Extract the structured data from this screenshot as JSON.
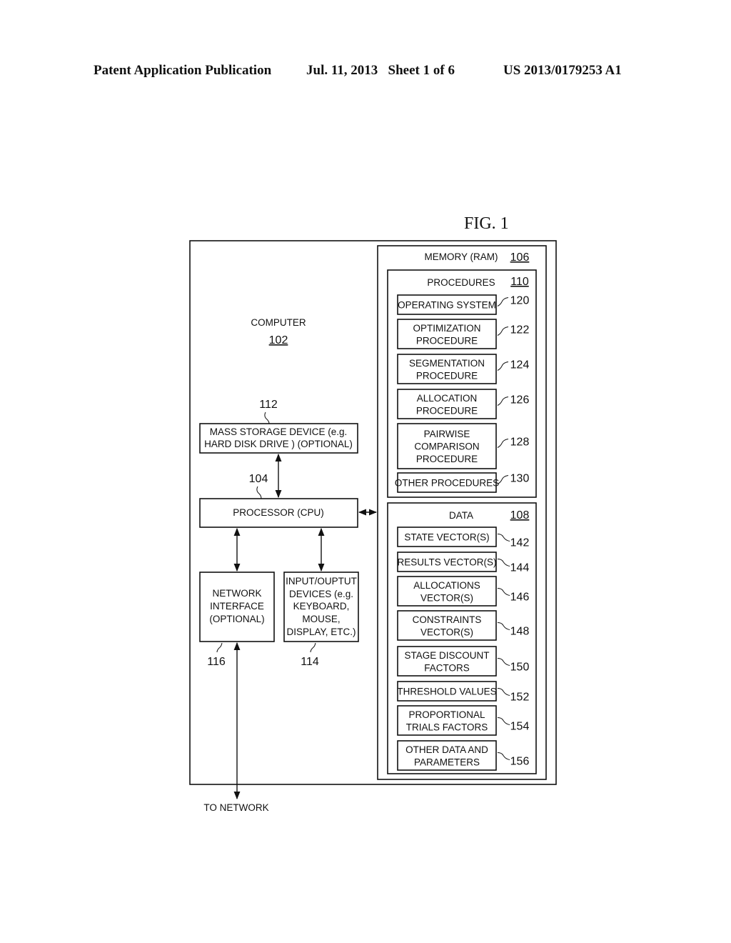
{
  "header": {
    "publication": "Patent Application Publication",
    "date_sheet": "Jul. 11, 2013   Sheet 1 of 6",
    "pub_number": "US 2013/0179253 A1"
  },
  "figure": {
    "title": "FIG. 1",
    "computer": {
      "label": "COMPUTER",
      "ref": "102"
    },
    "mass_storage": {
      "lines": [
        "MASS STORAGE DEVICE (e.g.",
        "HARD DISK DRIVE ) (OPTIONAL)"
      ],
      "ref": "112"
    },
    "processor": {
      "label": "PROCESSOR (CPU)",
      "ref": "104"
    },
    "network_interface": {
      "lines": [
        "NETWORK",
        "INTERFACE",
        "(OPTIONAL)"
      ],
      "ref": "116"
    },
    "io_devices": {
      "lines": [
        "INPUT/OUPTUT",
        "DEVICES (e.g.",
        "KEYBOARD,",
        "MOUSE,",
        "DISPLAY, ETC.)"
      ],
      "ref": "114"
    },
    "to_network": "TO NETWORK",
    "memory": {
      "label": "MEMORY (RAM)",
      "ref": "106"
    },
    "procedures": {
      "label": "PROCEDURES",
      "ref": "110",
      "items": [
        {
          "lines": [
            "OPERATING SYSTEM"
          ],
          "ref": "120"
        },
        {
          "lines": [
            "OPTIMIZATION",
            "PROCEDURE"
          ],
          "ref": "122"
        },
        {
          "lines": [
            "SEGMENTATION",
            "PROCEDURE"
          ],
          "ref": "124"
        },
        {
          "lines": [
            "ALLOCATION",
            "PROCEDURE"
          ],
          "ref": "126"
        },
        {
          "lines": [
            "PAIRWISE",
            "COMPARISON",
            "PROCEDURE"
          ],
          "ref": "128"
        },
        {
          "lines": [
            "OTHER PROCEDURES"
          ],
          "ref": "130"
        }
      ]
    },
    "data": {
      "label": "DATA",
      "ref": "108",
      "items": [
        {
          "lines": [
            "STATE VECTOR(S)"
          ],
          "ref": "142"
        },
        {
          "lines": [
            "RESULTS VECTOR(S)"
          ],
          "ref": "144"
        },
        {
          "lines": [
            "ALLOCATIONS",
            "VECTOR(S)"
          ],
          "ref": "146"
        },
        {
          "lines": [
            "CONSTRAINTS",
            "VECTOR(S)"
          ],
          "ref": "148"
        },
        {
          "lines": [
            "STAGE DISCOUNT",
            "FACTORS"
          ],
          "ref": "150"
        },
        {
          "lines": [
            "THRESHOLD VALUES"
          ],
          "ref": "152"
        },
        {
          "lines": [
            "PROPORTIONAL",
            "TRIALS FACTORS"
          ],
          "ref": "154"
        },
        {
          "lines": [
            "OTHER DATA AND",
            "PARAMETERS"
          ],
          "ref": "156"
        }
      ]
    }
  }
}
